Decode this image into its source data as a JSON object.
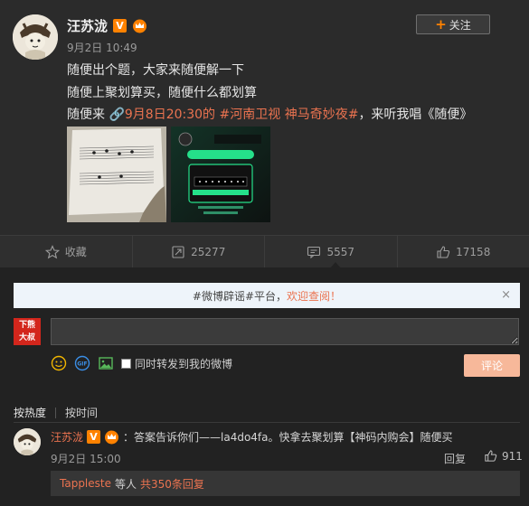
{
  "post": {
    "author": "汪苏泷",
    "badge_v": "V",
    "time": "9月2日 10:49",
    "follow_label": "关注",
    "line1": "随便出个题，大家来随便解一下",
    "line2": "随便上聚划算买，随便什么都划算",
    "line3_prefix": "随便来",
    "line3_link": "9月8日20:30的",
    "line3_topic": "#河南卫视 神马奇妙夜#",
    "line3_suffix": "，来听我唱《随便》"
  },
  "actions": [
    {
      "icon": "star-icon",
      "label": "收藏"
    },
    {
      "icon": "repost-icon",
      "label": "25277"
    },
    {
      "icon": "comment-icon",
      "label": "5557"
    },
    {
      "icon": "like-icon",
      "label": "17158"
    }
  ],
  "notice": {
    "prefix": "#微博辟谣#平台，",
    "link": "欢迎查阅！",
    "close": "×"
  },
  "composer": {
    "logo_line1": "下熊",
    "logo_line2": "大叔",
    "repost_label": "同时转发到我的微博",
    "submit_label": "评论"
  },
  "sort": {
    "hot": "按热度",
    "time": "按时间"
  },
  "comment": {
    "author": "汪苏泷",
    "text": "：答案告诉你们——la4do4fa。快拿去聚划算【神码内购会】随便买",
    "time": "9月2日 15:00",
    "reply_label": "回复",
    "likes": "911"
  },
  "replies_summary": {
    "user": "Tappleste",
    "middle": " 等人 ",
    "count": "共350条回复"
  },
  "colors": {
    "accent": "#eb7350",
    "vip_orange": "#ff8200",
    "background": "#2b2b2b"
  }
}
